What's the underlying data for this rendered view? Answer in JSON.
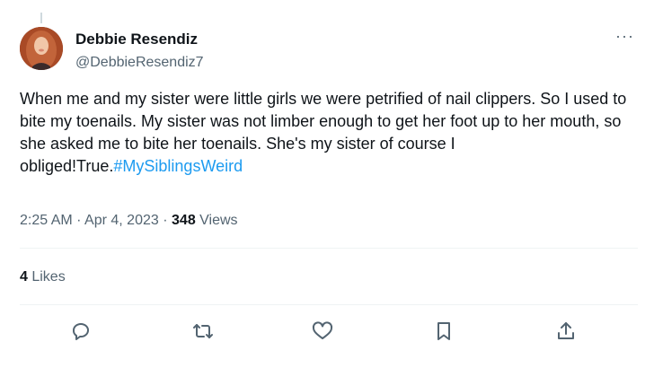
{
  "author": {
    "display_name": "Debbie Resendiz",
    "handle": "@DebbieResendiz7",
    "avatar_icon": "profile-photo"
  },
  "more_icon": "more-horizontal-icon",
  "tweet": {
    "text": "When me and my sister were little girls we were petrified of nail clippers. So I used to bite my toenails. My sister was not limber enough to get her foot up to her mouth, so she asked me to bite her toenails. She's my sister of course I obliged!True.",
    "hashtag": "#MySiblingsWeird"
  },
  "meta": {
    "time": "2:25 AM",
    "separator": "·",
    "date": "Apr 4, 2023",
    "views_count": "348",
    "views_label": " Views"
  },
  "likes": {
    "count": "4",
    "label": " Likes"
  },
  "actions": [
    "reply-icon",
    "retweet-icon",
    "like-icon",
    "bookmark-icon",
    "share-icon"
  ],
  "colors": {
    "text": "#0f1419",
    "secondary": "#536471",
    "link": "#1d9bf0",
    "divider": "#eff3f4"
  }
}
